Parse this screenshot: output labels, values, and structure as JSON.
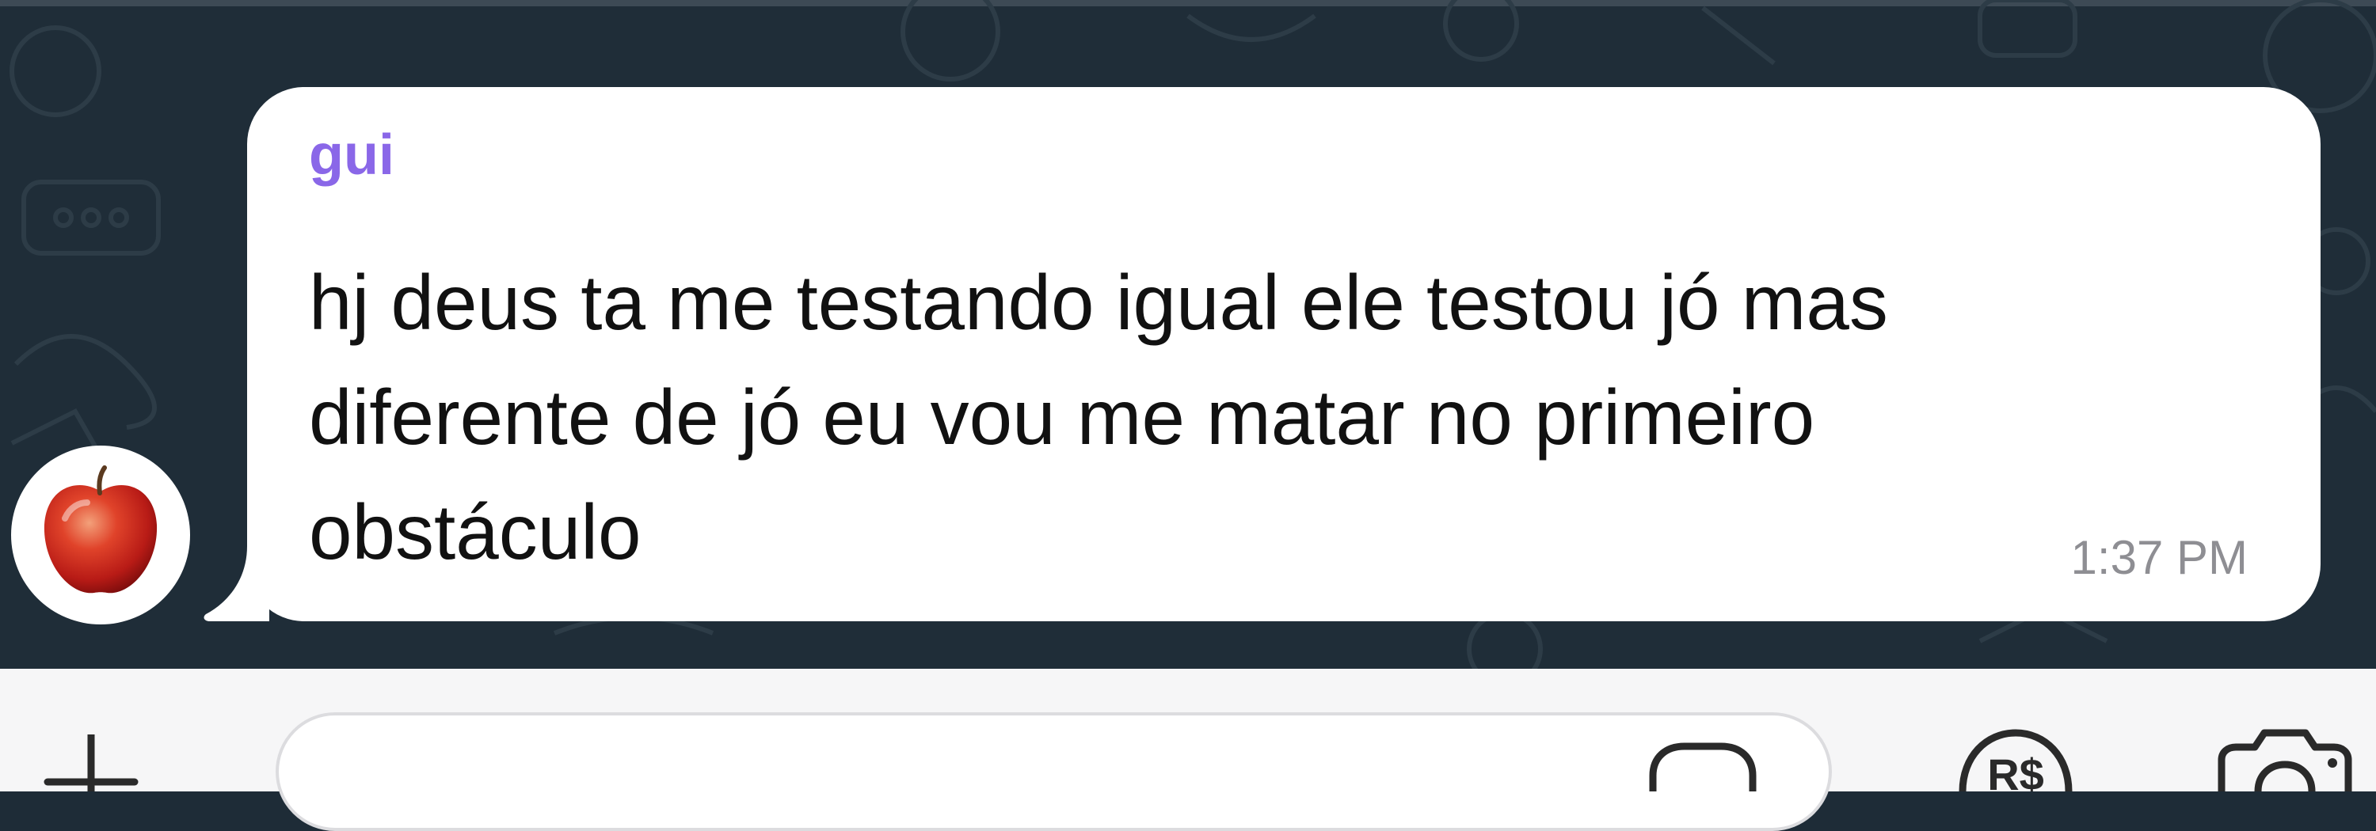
{
  "chat": {
    "sender_name": "gui",
    "message_lines": [
      "hj deus ta me testando igual ele testou jó mas",
      "diferente de jó eu vou me matar no primeiro",
      "obstáculo"
    ],
    "timestamp": "1:37 PM",
    "avatar_icon": "apple-icon"
  },
  "input_bar": {
    "placeholder": "",
    "icons": [
      "plus-icon",
      "sticker-icon",
      "payment-icon",
      "camera-icon"
    ]
  },
  "colors": {
    "chat_background": "#1f2d38",
    "bubble": "#ffffff",
    "sender_name": "#8a67e8",
    "timestamp": "#8e8e93",
    "input_bar": "#f6f6f7"
  }
}
